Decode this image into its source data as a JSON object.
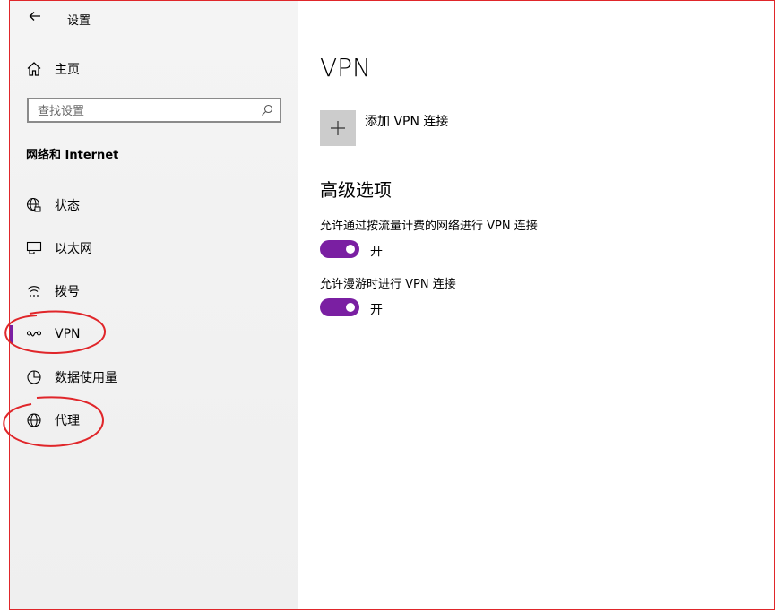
{
  "window": {
    "title": "设置"
  },
  "sidebar": {
    "home_label": "主页",
    "search_placeholder": "查找设置",
    "section_title": "网络和 Internet",
    "items": [
      {
        "label": "状态",
        "icon": "globe-status-icon"
      },
      {
        "label": "以太网",
        "icon": "ethernet-icon"
      },
      {
        "label": "拨号",
        "icon": "dialup-icon"
      },
      {
        "label": "VPN",
        "icon": "vpn-icon",
        "active": true
      },
      {
        "label": "数据使用量",
        "icon": "data-usage-icon"
      },
      {
        "label": "代理",
        "icon": "globe-icon"
      }
    ]
  },
  "main": {
    "title": "VPN",
    "add_vpn_label": "添加 VPN 连接",
    "advanced_title": "高级选项",
    "options": [
      {
        "label": "允许通过按流量计费的网络进行 VPN 连接",
        "state": "开",
        "on": true
      },
      {
        "label": "允许漫游时进行 VPN 连接",
        "state": "开",
        "on": true
      }
    ]
  },
  "colors": {
    "accent": "#7a1fa2",
    "annotation": "#e0262a",
    "sidebar_bg": "#f2f2f2",
    "add_tile_bg": "#cccccc"
  }
}
